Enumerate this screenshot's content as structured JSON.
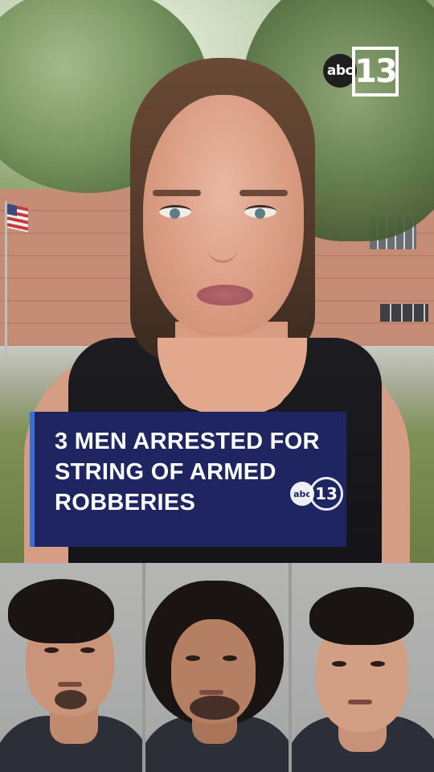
{
  "station_logo": {
    "abc": "abc",
    "number": "13"
  },
  "headline": {
    "lines": [
      "3 MEN ARRESTED FOR",
      "STRING OF ARMED",
      "ROBBERIES"
    ],
    "bug_abc": "abc",
    "bug_number": "13"
  },
  "colors": {
    "headline_bg": "#1e2560",
    "headline_accent": "#3b6fd8",
    "headline_text": "#ffffff"
  },
  "mugshots": [
    {
      "id": "suspect-1"
    },
    {
      "id": "suspect-2"
    },
    {
      "id": "suspect-3"
    }
  ]
}
